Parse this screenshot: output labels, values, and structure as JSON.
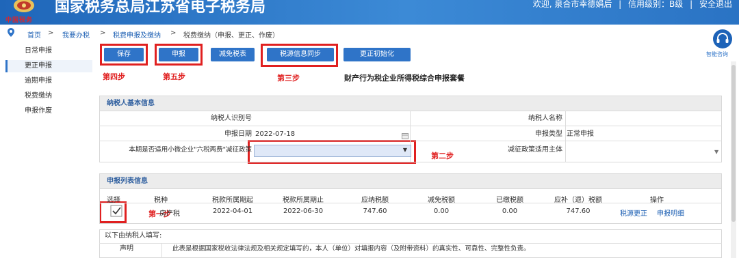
{
  "header": {
    "site_title": "国家税务总局江苏省电子税务局",
    "logo_text": "中国税务",
    "welcome": "欢迎, 泉合市幸德娟后",
    "credit_label": "信用级别：B级",
    "logout_label": "安全退出",
    "sep": "|"
  },
  "breadcrumb": {
    "home": "首页",
    "sep": ">",
    "level1": "我要办税",
    "level2": "税费申报及缴纳",
    "level3": "税费缴纳（申报、更正、作废）"
  },
  "sidebar": {
    "items": [
      {
        "label": "日常申报"
      },
      {
        "label": "更正申报"
      },
      {
        "label": "逾期申报"
      },
      {
        "label": "税费缴纳"
      },
      {
        "label": "申报作废"
      }
    ]
  },
  "help": {
    "label": "智能咨询"
  },
  "toolbar": {
    "save_label": "保存",
    "declare_label": "申报",
    "reduce_label": "减免税表",
    "sync_label": "税源信息同步",
    "reset_label": "更正初始化"
  },
  "steps": {
    "step1": "第一步",
    "step2": "第二步",
    "step3": "第三步",
    "step4": "第四步",
    "step5": "第五步"
  },
  "form_title": "财产行为税企业所得税综合申报套餐",
  "taxpayer_section": {
    "title": "纳税人基本信息",
    "id_label": "纳税人识别号",
    "id_value": "",
    "name_label": "纳税人名称",
    "name_value": "",
    "date_label": "申报日期",
    "date_value": "2022-07-18",
    "type_label": "申报类型",
    "type_value": "正常申报",
    "policy_label": "本期是否适用小微企业\"六税两费\"减征政策",
    "policy_value": "",
    "subject_label": "减征政策适用主体",
    "subject_value": ""
  },
  "list_section": {
    "title": "申报列表信息",
    "headers": [
      "选择",
      "税种",
      "税款所属期起",
      "税款所属期止",
      "应纳税额",
      "减免税额",
      "已缴税额",
      "应补（退）税额",
      "操作"
    ],
    "rows": [
      {
        "tax_type": "房产税",
        "period_start": "2022-04-01",
        "period_end": "2022-06-30",
        "payable": "747.60",
        "reduced": "0.00",
        "paid": "0.00",
        "due": "747.60",
        "op1": "税源更正",
        "op2": "申报明细"
      }
    ]
  },
  "declaration": {
    "intro": "以下由纳税人填写:",
    "label": "声明",
    "text": "此表是根据国家税收法律法规及相关规定填写的，本人（单位）对填报内容（及附带资料）的真实性、可靠性、完整性负责。"
  },
  "colors": {
    "banner": "#2a73c4",
    "button": "#2f74c8",
    "annotation": "#e02020",
    "link": "#1c5fb3"
  }
}
